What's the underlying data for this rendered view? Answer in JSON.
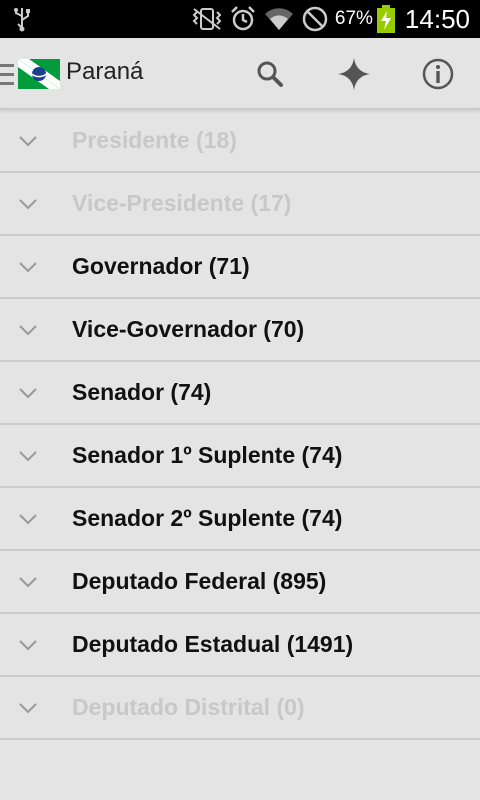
{
  "status_bar": {
    "battery_percent": "67%",
    "time": "14:50",
    "icons": [
      "usb-icon",
      "vibrate-icon",
      "alarm-icon",
      "wifi-icon",
      "no-signal-icon",
      "battery-charging-icon"
    ]
  },
  "action_bar": {
    "title": "Paraná",
    "icons": [
      "drawer-icon",
      "parana-flag-icon",
      "search-icon",
      "favorites-icon",
      "info-icon"
    ]
  },
  "offices": [
    {
      "label": "Presidente (18)",
      "enabled": false
    },
    {
      "label": "Vice-Presidente (17)",
      "enabled": false
    },
    {
      "label": "Governador (71)",
      "enabled": true
    },
    {
      "label": "Vice-Governador (70)",
      "enabled": true
    },
    {
      "label": "Senador (74)",
      "enabled": true
    },
    {
      "label": "Senador 1º Suplente (74)",
      "enabled": true
    },
    {
      "label": "Senador 2º Suplente (74)",
      "enabled": true
    },
    {
      "label": "Deputado Federal (895)",
      "enabled": true
    },
    {
      "label": "Deputado Estadual (1491)",
      "enabled": true
    },
    {
      "label": "Deputado Distrital (0)",
      "enabled": false
    }
  ],
  "colors": {
    "background": "#e4e4e4",
    "enabled_text": "#111111",
    "disabled_text": "#c8c8c8",
    "divider": "#cbcbcb"
  }
}
